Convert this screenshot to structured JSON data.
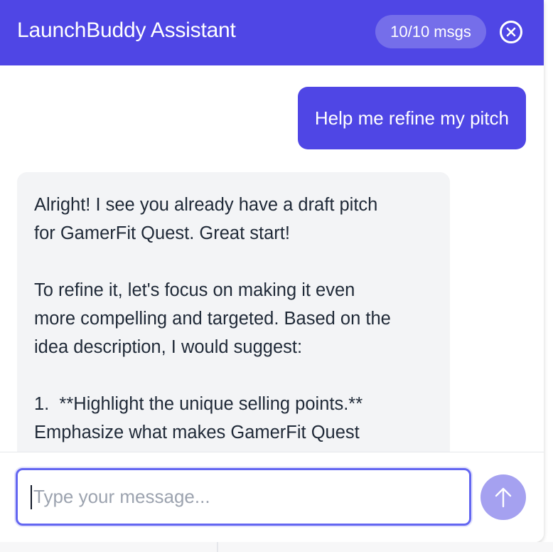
{
  "header": {
    "title": "LaunchBuddy Assistant",
    "message_count": "10/10 msgs",
    "close_icon": "close-circle-icon"
  },
  "messages": {
    "user": {
      "text": "Help me refine my pitch"
    },
    "assistant": {
      "line1": "Alright! I see you already have a draft pitch",
      "line2": "for GamerFit Quest. Great start!",
      "line3": "To refine it, let's focus on making it even",
      "line4": "more compelling and targeted. Based on the",
      "line5": "idea description, I would suggest:",
      "line6": "1.  **Highlight the unique selling points.**",
      "line7": "Emphasize what makes GamerFit Quest"
    }
  },
  "composer": {
    "placeholder": "Type your message...",
    "value": "",
    "send_icon": "arrow-up-icon"
  },
  "colors": {
    "accent": "#4f46e5",
    "send_disabled": "#a5a1f0",
    "assistant_bubble": "#f3f4f6",
    "input_border": "#6366f1"
  }
}
